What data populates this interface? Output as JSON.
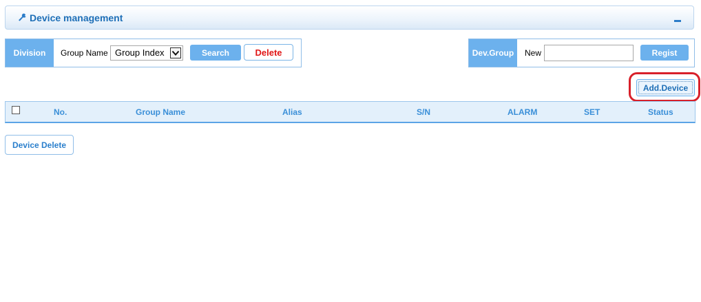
{
  "header": {
    "title": "Device management",
    "icon": "wrench-icon",
    "collapse_icon": "minus-icon"
  },
  "division": {
    "label": "Division",
    "group_name_label": "Group Name",
    "group_select_value": "Group Index",
    "search_label": "Search",
    "delete_label": "Delete"
  },
  "dev_group": {
    "label": "Dev.Group",
    "new_label": "New",
    "new_value": "",
    "regist_label": "Regist"
  },
  "add_device_label": "Add.Device",
  "table": {
    "columns": [
      "No.",
      "Group Name",
      "Alias",
      "S/N",
      "ALARM",
      "SET",
      "Status"
    ]
  },
  "device_delete_label": "Device Delete",
  "colors": {
    "accent": "#6cb1ed",
    "title_text": "#1e6fb7",
    "delete_text": "#e01616",
    "highlight": "#d8202a"
  }
}
